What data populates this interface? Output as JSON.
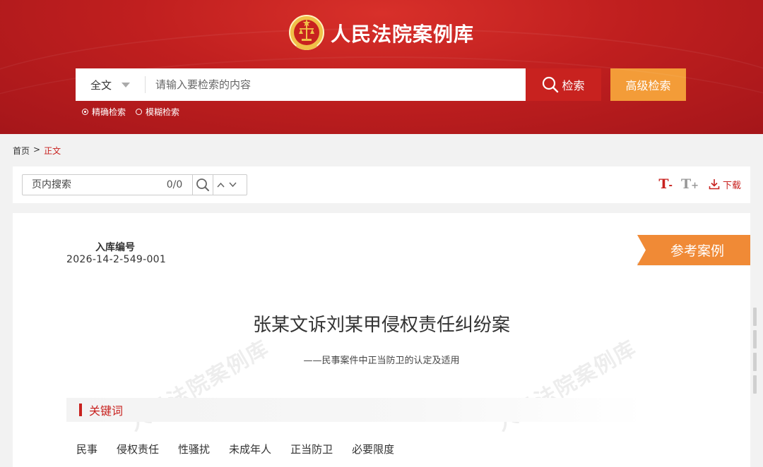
{
  "header": {
    "site_name": "人民法院案例库",
    "search": {
      "scope_label": "全文",
      "placeholder": "请输入要检索的内容",
      "search_button": "检索",
      "advanced_button": "高级检索",
      "modes": [
        {
          "label": "精确检索",
          "selected": true
        },
        {
          "label": "模糊检索",
          "selected": false
        }
      ]
    }
  },
  "breadcrumb": {
    "home": "首页",
    "separator": ">",
    "current": "正文"
  },
  "toolbar": {
    "find_placeholder": "页内搜索",
    "find_count": "0/0",
    "text_smaller": "T",
    "text_smaller_sign": "-",
    "text_larger": "T",
    "text_larger_sign": "+",
    "download_label": "下载"
  },
  "document": {
    "entry_label": "入库编号",
    "entry_number": "2026-14-2-549-001",
    "badge": "参考案例",
    "title": "张某文诉刘某甲侵权责任纠纷案",
    "subtitle": "——民事案件中正当防卫的认定及适用",
    "keywords_heading": "关键词",
    "keywords": [
      "民事",
      "侵权责任",
      "性骚扰",
      "未成年人",
      "正当防卫",
      "必要限度"
    ],
    "watermark": "人民法院案例库"
  },
  "colors": {
    "brand_red": "#c8221f",
    "accent_orange": "#f39c38",
    "ribbon_orange": "#f08a36"
  }
}
